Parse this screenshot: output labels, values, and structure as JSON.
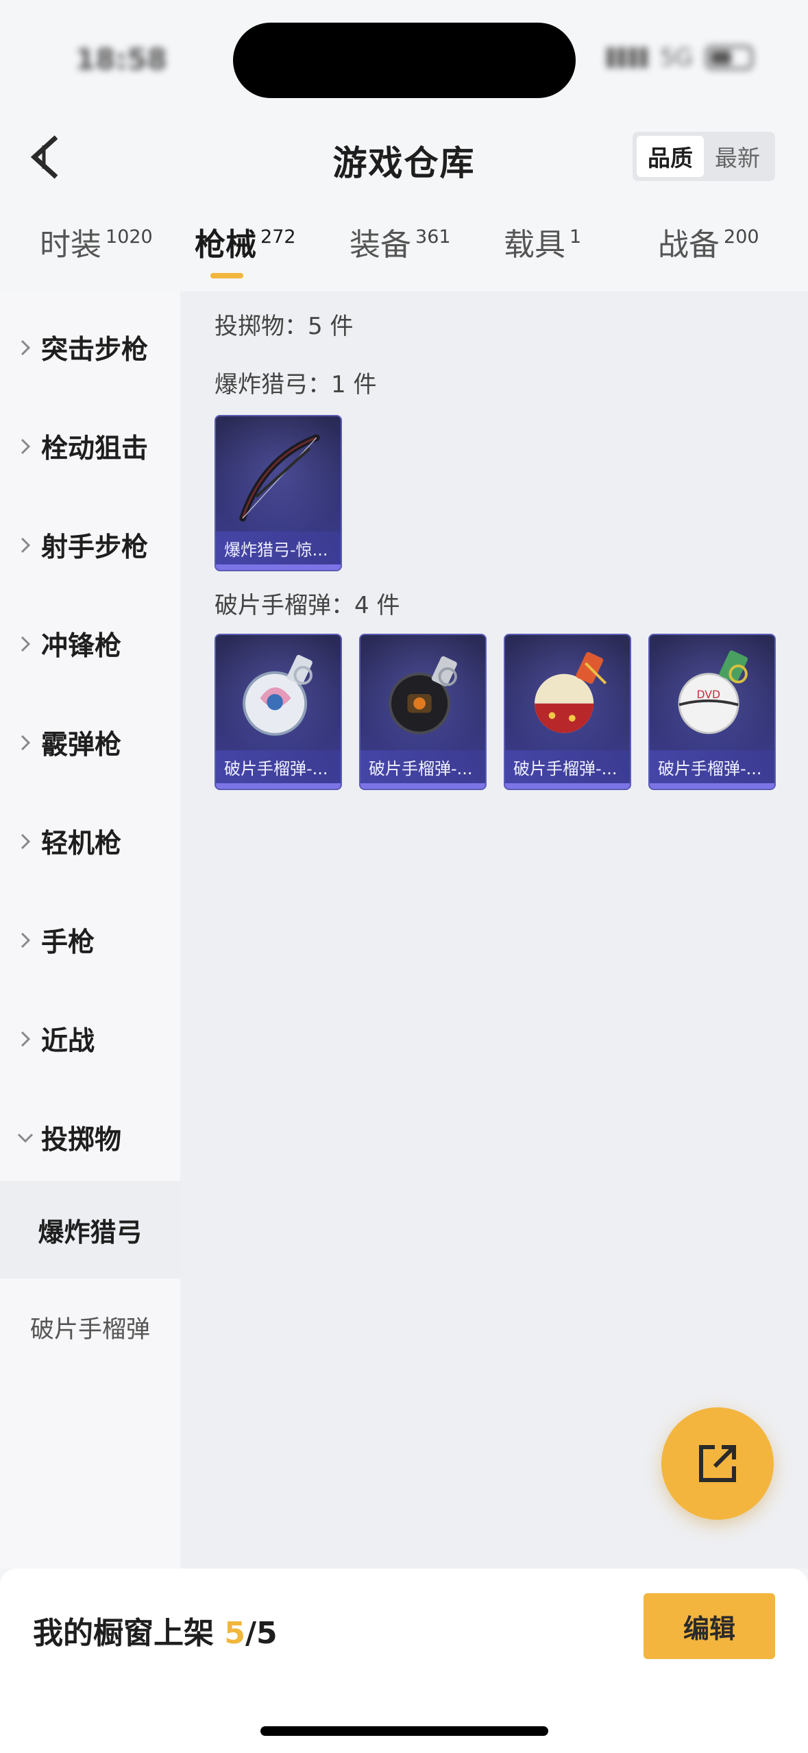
{
  "status_bar": {
    "time": "18:58",
    "network": "5G"
  },
  "header": {
    "title": "游戏仓库",
    "sort_options": [
      "品质",
      "最新"
    ],
    "sort_active": "品质"
  },
  "tabs": [
    {
      "label": "时装",
      "count": "1020"
    },
    {
      "label": "枪械",
      "count": "272"
    },
    {
      "label": "装备",
      "count": "361"
    },
    {
      "label": "载具",
      "count": "1"
    },
    {
      "label": "战备",
      "count": "200"
    }
  ],
  "sidebar": {
    "items": [
      "突击步枪",
      "栓动狙击",
      "射手步枪",
      "冲锋枪",
      "霰弹枪",
      "轻机枪",
      "手枪",
      "近战",
      "投掷物"
    ],
    "subitems": [
      "爆炸猎弓",
      "破片手榴弹"
    ]
  },
  "content": {
    "category_summary": "投掷物：5 件",
    "groups": [
      {
        "label": "爆炸猎弓：1 件",
        "items": [
          "爆炸猎弓-惊..."
        ]
      },
      {
        "label": "破片手榴弹：4 件",
        "items": [
          "破片手榴弹-...",
          "破片手榴弹-...",
          "破片手榴弹-...",
          "破片手榴弹-..."
        ]
      }
    ]
  },
  "bottom": {
    "shelf_label": "我的橱窗上架",
    "shelf_used": "5",
    "shelf_total": "/5",
    "edit_label": "编辑"
  },
  "colors": {
    "accent": "#f3b53e",
    "card_bg": "#343577",
    "page_bg": "#eeeff2"
  }
}
